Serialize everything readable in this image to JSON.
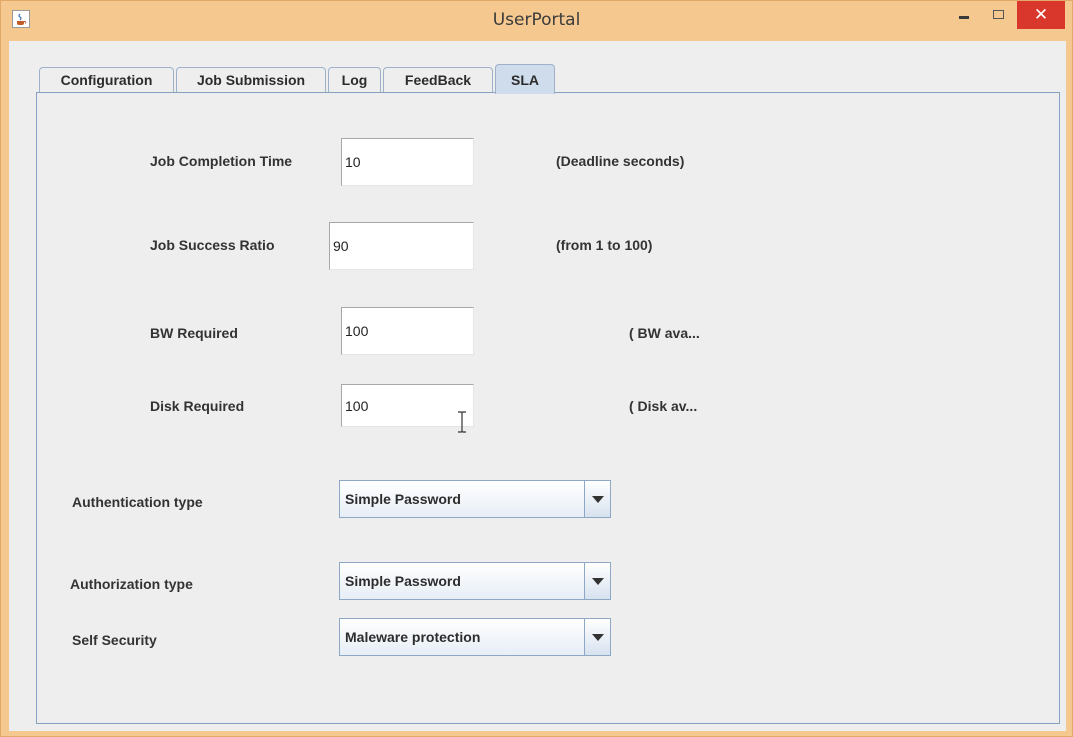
{
  "window": {
    "title": "UserPortal",
    "close_glyph": "✕",
    "icons": {
      "app": "java-cup-icon",
      "minimize": "minimize-icon",
      "maximize": "maximize-icon",
      "close": "close-icon"
    }
  },
  "tabs": [
    {
      "label": "Configuration",
      "active": false
    },
    {
      "label": "Job Submission",
      "active": false
    },
    {
      "label": "Log",
      "active": false
    },
    {
      "label": "FeedBack",
      "active": false
    },
    {
      "label": "SLA",
      "active": true
    }
  ],
  "form": {
    "job_completion": {
      "label": "Job Completion Time",
      "value": "10",
      "hint": "(Deadline seconds)"
    },
    "job_success": {
      "label": "Job Success Ratio",
      "value": "90",
      "hint": "(from 1 to 100)"
    },
    "bw": {
      "label": "BW Required",
      "value": "100",
      "hint": "( BW ava..."
    },
    "disk": {
      "label": "Disk Required",
      "value": "100",
      "hint": "( Disk av..."
    },
    "authentication": {
      "label": "Authentication type",
      "selected": "Simple Password"
    },
    "authorization": {
      "label": "Authorization type",
      "selected": "Simple Password"
    },
    "self_security": {
      "label": "Self Security",
      "selected": "Maleware protection"
    }
  },
  "colors": {
    "title_bar": "#f5c88f",
    "close_button": "#d9372c",
    "panel_background": "#eeeeee",
    "active_tab": "#cfdcec",
    "border_accent": "#86a0bf"
  }
}
